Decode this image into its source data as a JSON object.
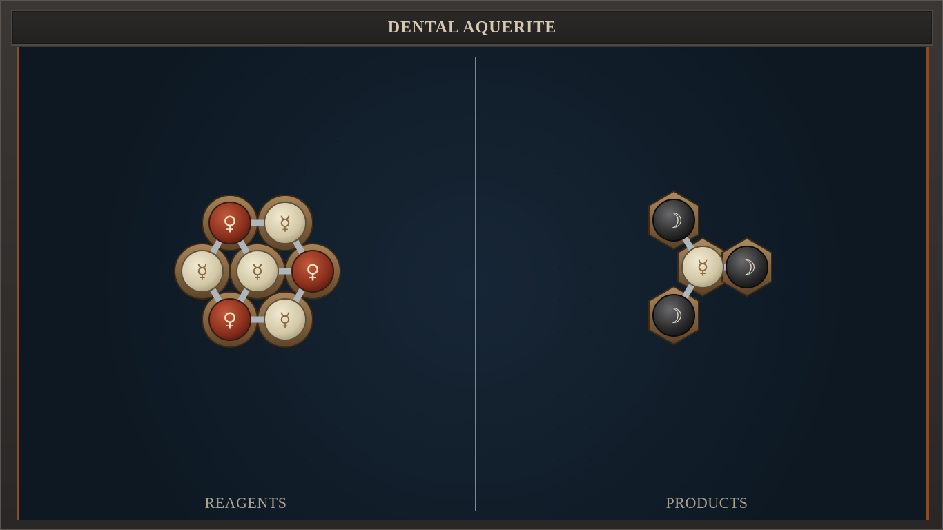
{
  "title": "DENTAL AQUERITE",
  "panels": {
    "reagents_label": "REAGENTS",
    "products_label": "PRODUCTS"
  },
  "symbols": {
    "venus": "♀",
    "mercury": "☿",
    "moon": "☽"
  },
  "colors": {
    "venus_atom": "#9b3a24",
    "mercury_atom": "#d9cfb2",
    "moon_atom": "#2a2a2b",
    "bond": "#aeb6bb",
    "brass": "#8a6a44"
  },
  "reagent_atoms": [
    "venus",
    "mercury",
    "mercury",
    "mercury",
    "venus",
    "venus",
    "mercury"
  ],
  "product_atoms": [
    "moon",
    "mercury",
    "moon",
    "moon"
  ]
}
